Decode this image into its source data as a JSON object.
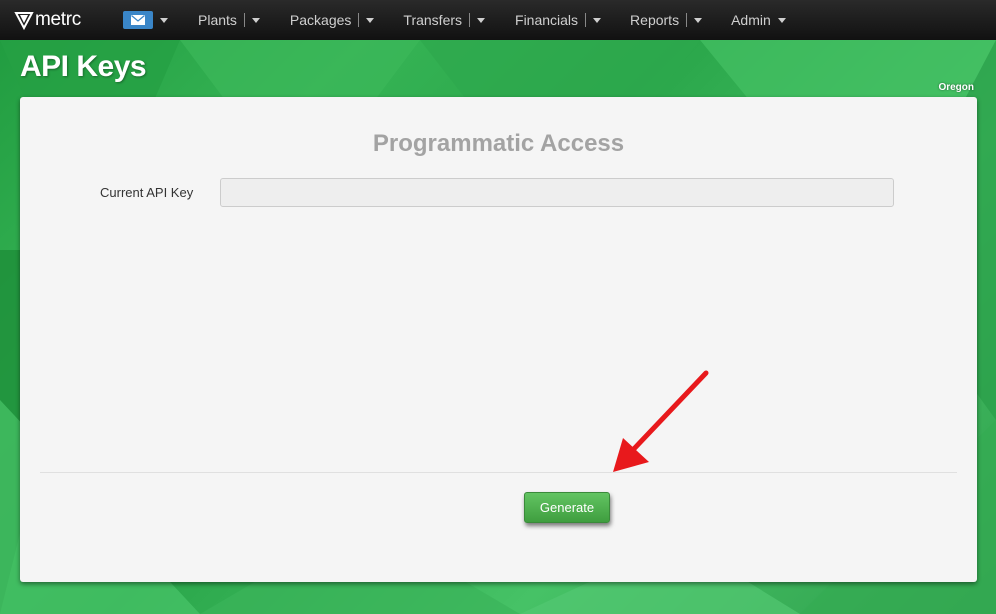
{
  "app": {
    "logo_text": "metrc",
    "logo_icon": "metrc-shield-icon"
  },
  "nav": {
    "mail_icon": "envelope-icon",
    "items": [
      {
        "label": "Plants"
      },
      {
        "label": "Packages"
      },
      {
        "label": "Transfers"
      },
      {
        "label": "Financials"
      },
      {
        "label": "Reports"
      },
      {
        "label": "Admin"
      }
    ]
  },
  "page": {
    "title": "API Keys",
    "state": "Oregon"
  },
  "panel": {
    "heading": "Programmatic Access",
    "api_key_label": "Current API Key",
    "api_key_value": "",
    "generate_label": "Generate"
  },
  "colors": {
    "nav_bg": "#1a1a1a",
    "brand_green": "#2fa84f",
    "button_green": "#4cae4c",
    "mail_blue": "#3a86c8",
    "annotation_red": "#e8191c"
  }
}
